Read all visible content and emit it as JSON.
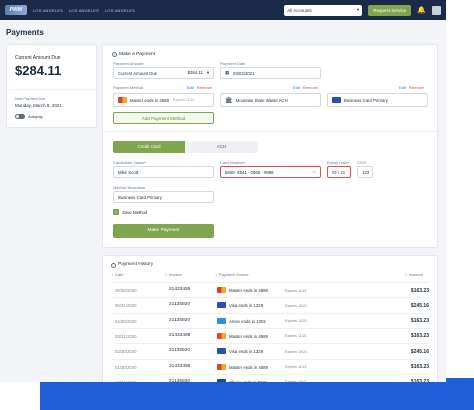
{
  "topbar": {
    "logo": "PWW",
    "tabs": [
      "LOS ANGELES",
      "LOS ANGELES",
      "LOS ANGELES"
    ],
    "account_select": "All Accounts",
    "request_service": "Request Service"
  },
  "page": {
    "title": "Payments"
  },
  "summary": {
    "current_label": "Current Amount Due",
    "current_amount": "$284.11",
    "next_label": "Next Payment Due",
    "next_date": "Monday, March 8, 2021",
    "autopay_label": "Autopay"
  },
  "make_payment": {
    "title": "Make a Payment",
    "amount_label": "Payment Amount",
    "amount_option": "Current Amount Due",
    "amount_value": "$284.11",
    "date_label": "Payment Date",
    "date_value": "03/02/2021",
    "method_label": "Payment Method",
    "edit": "Edit",
    "remove": "Remove",
    "methods": [
      {
        "name": "Master ends in 4589",
        "expiry": "Expires 11/21"
      },
      {
        "name": "Mountain State Waste ACH",
        "expiry": ""
      },
      {
        "name": "Business Card Primary",
        "expiry": ""
      }
    ],
    "add_method": "Add Payment Method"
  },
  "form": {
    "tab_credit": "Credit Card",
    "tab_ach": "ACH",
    "cardholder_label": "Cardholder Name*",
    "cardholder_value": "Mike Scott",
    "cardnum_label": "Card Number*",
    "cardnum_value": "5600- 8541 - 0068 - 9988",
    "expiry_label": "Expiry Date*",
    "expiry_value": "02 / 21",
    "cvv_label": "CVV*",
    "cvv_value": "123",
    "nickname_label": "Method Nickname",
    "nickname_value": "Business Card Primary",
    "save_method": "Save Method",
    "submit": "Make Payment"
  },
  "history": {
    "title": "Payment History",
    "columns": [
      "Date",
      "Invoice",
      "Payment Source",
      "Amount"
    ],
    "rows": [
      {
        "date": "06/30/2020",
        "invoice": "21433495",
        "source": "Master ends in 4589",
        "expiry": "Expires 11/21",
        "amount": "$163.23",
        "brand": "master"
      },
      {
        "date": "05/31/2020",
        "invoice": "21135920",
        "source": "Visa ends in 1329",
        "expiry": "Expires 10/21",
        "amount": "$245.16",
        "brand": "visa"
      },
      {
        "date": "04/30/2020",
        "invoice": "21135920",
        "source": "Amex ends in 1002",
        "expiry": "Expires 10/21",
        "amount": "$163.23",
        "brand": "amex"
      },
      {
        "date": "03/31/2020",
        "invoice": "21433495",
        "source": "Master ends in 4589",
        "expiry": "Expires 11/21",
        "amount": "$163.23",
        "brand": "master"
      },
      {
        "date": "02/30/2020",
        "invoice": "21135920",
        "source": "Visa ends in 1329",
        "expiry": "Expires 10/21",
        "amount": "$245.16",
        "brand": "visa"
      },
      {
        "date": "01/30/2020",
        "invoice": "21433495",
        "source": "Master ends in 4589",
        "expiry": "Expires 11/21",
        "amount": "$163.23",
        "brand": "master"
      },
      {
        "date": "12/31/2019",
        "invoice": "21135920",
        "source": "Chase ends in 5521",
        "expiry": "Expires 10/21",
        "amount": "$163.23",
        "brand": "chase"
      }
    ]
  },
  "colors": {
    "navy": "#1b2b47",
    "green": "#7fa64e",
    "blue": "#1e5fd8",
    "error": "#e05050"
  }
}
